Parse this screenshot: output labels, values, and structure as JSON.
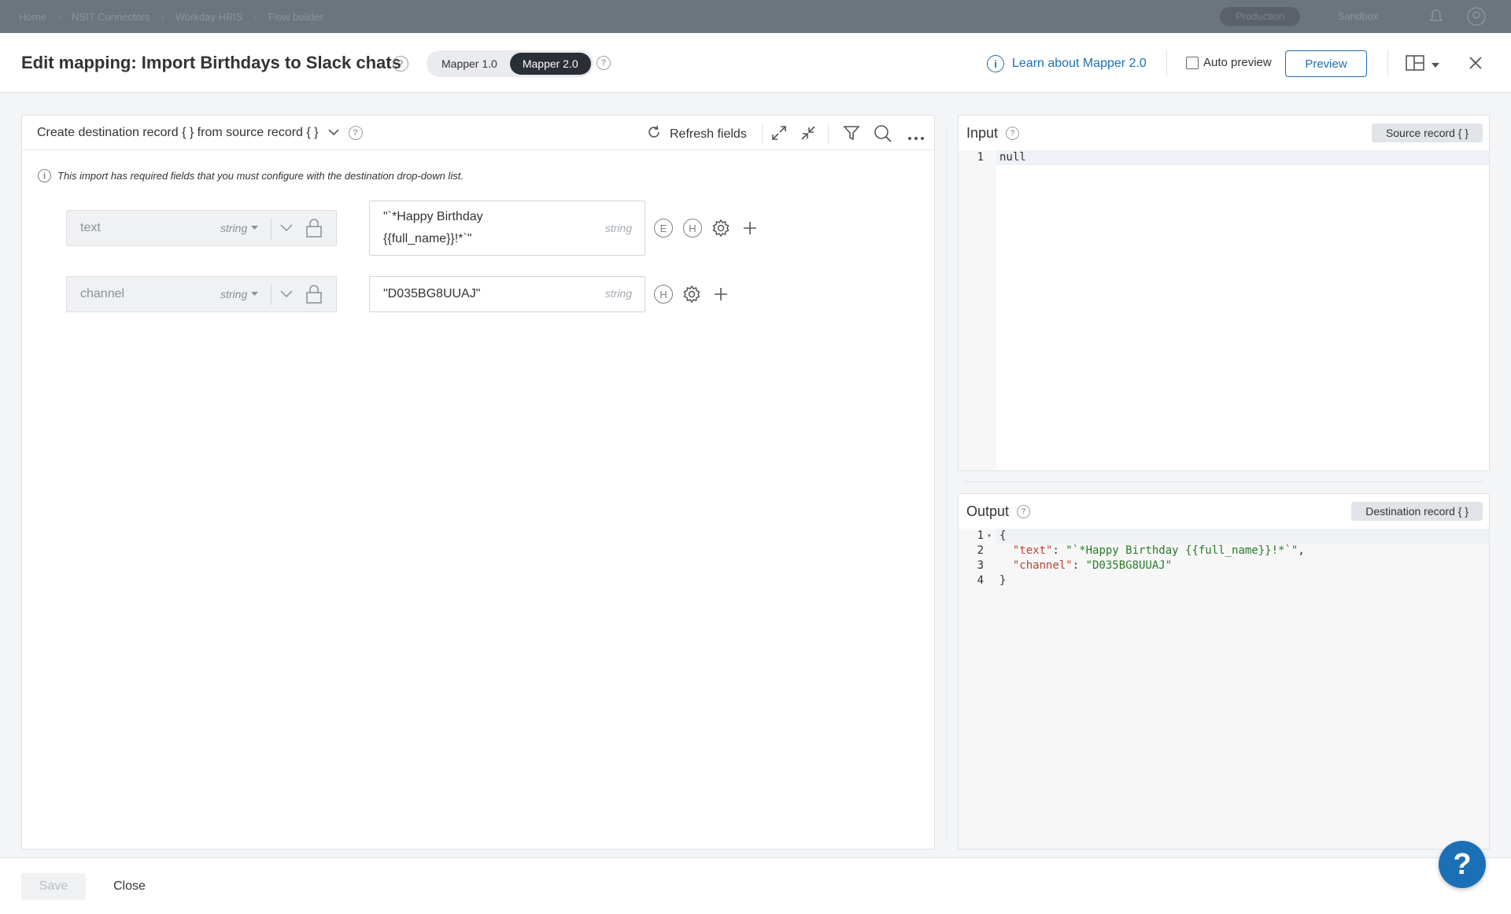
{
  "topbar": {
    "breadcrumbs": [
      "Home",
      "NSIT Connectors",
      "Workday HRIS",
      "Flow builder"
    ],
    "env_production": "Production",
    "env_sandbox": "Sandbox"
  },
  "header": {
    "title": "Edit mapping: Import Birthdays to Slack chats",
    "mapper_v1": "Mapper 1.0",
    "mapper_v2": "Mapper 2.0",
    "active_mapper": "Mapper 2.0",
    "learn_link": "Learn about Mapper 2.0",
    "auto_preview_label": "Auto preview",
    "auto_preview_checked": false,
    "preview_button": "Preview"
  },
  "mapping_panel": {
    "title": "Create destination record { } from source record { }",
    "refresh_label": "Refresh fields",
    "info_note": "This import has required fields that you must configure with the destination drop-down list.",
    "rows": [
      {
        "source_name": "text",
        "source_type": "string",
        "destination_line1": "\"`*Happy Birthday",
        "destination_line2": "{{full_name}}!*`\"",
        "destination_type": "string",
        "badges": [
          "E",
          "H"
        ]
      },
      {
        "source_name": "channel",
        "source_type": "string",
        "destination_line1": "\"D035BG8UUAJ\"",
        "destination_type": "string",
        "badges": [
          "H"
        ]
      }
    ]
  },
  "input_panel": {
    "label": "Input",
    "badge": "Source record { }",
    "lines": [
      {
        "num": "1",
        "text": "null"
      }
    ]
  },
  "output_panel": {
    "label": "Output",
    "badge": "Destination record { }",
    "line1_num": "1",
    "line1_text": "{",
    "line2_num": "2",
    "line2_key": "\"text\"",
    "line2_value": "\"`*Happy Birthday {{full_name}}!*`\"",
    "line3_num": "3",
    "line3_key": "\"channel\"",
    "line3_value": "\"D035BG8UUAJ\"",
    "line4_num": "4",
    "line4_text": "}"
  },
  "footer": {
    "save_label": "Save",
    "close_label": "Close"
  },
  "help_fab": "?",
  "colors": {
    "accent": "#1b6fb5",
    "segment_active": "#2a2f35",
    "json_key": "#b5452d",
    "json_string": "#2a7a2a"
  }
}
